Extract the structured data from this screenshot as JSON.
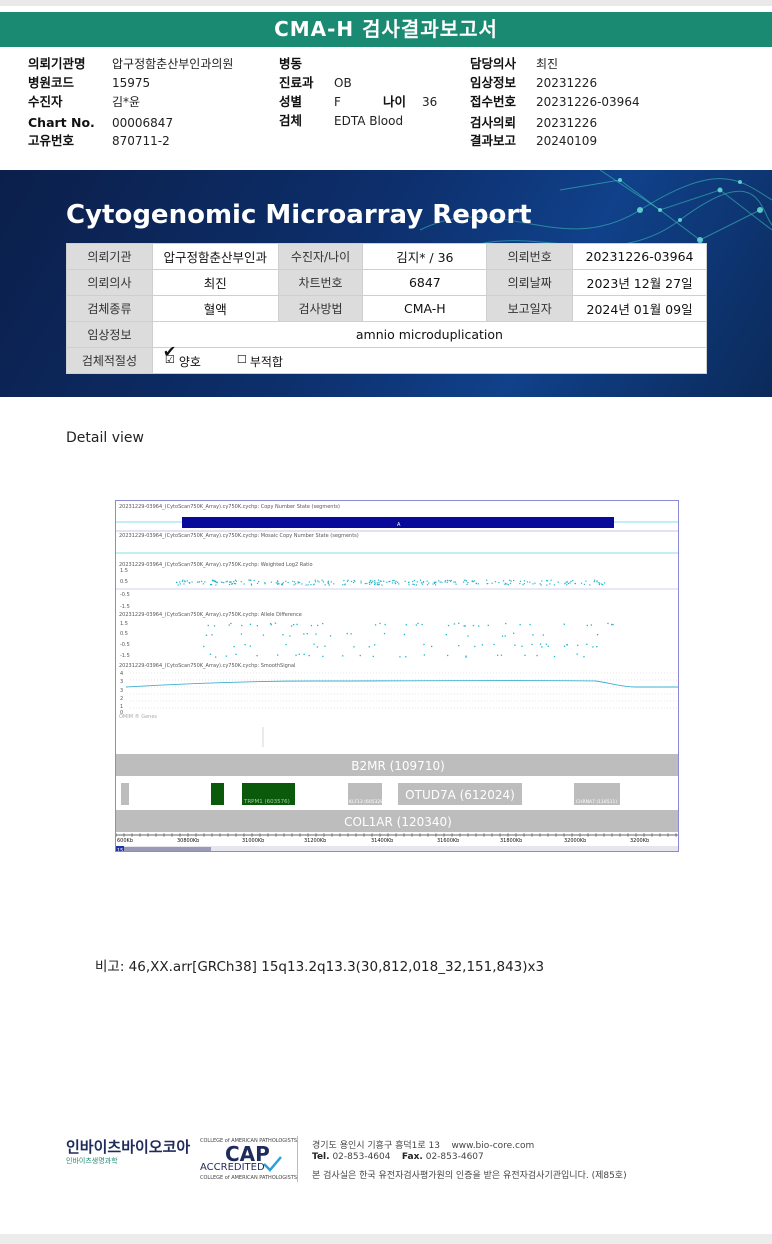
{
  "header": {
    "title": "CMA-H 검사결과보고서"
  },
  "info": {
    "col1": [
      {
        "label": "의뢰기관명",
        "value": "압구정함춘산부인과의원"
      },
      {
        "label": "병원코드",
        "value": "15975"
      },
      {
        "label": "수진자",
        "value": "김*윤"
      },
      {
        "label": "Chart No.",
        "value": "00006847"
      },
      {
        "label": "고유번호",
        "value": "870711-2"
      }
    ],
    "col2": [
      {
        "label": "병동",
        "value": ""
      },
      {
        "label": "진료과",
        "value": "OB"
      },
      {
        "label": "성별",
        "value": "F"
      },
      {
        "label": "검체",
        "value": "EDTA Blood"
      }
    ],
    "age_label": "나이",
    "age_value": "36",
    "col3": [
      {
        "label": "담당의사",
        "value": "최진"
      },
      {
        "label": "임상정보",
        "value": "20231226"
      },
      {
        "label": "접수번호",
        "value": "20231226-03964"
      },
      {
        "label": "검사의뢰",
        "value": "20231226"
      },
      {
        "label": "결과보고",
        "value": "20240109"
      }
    ]
  },
  "report": {
    "title": "Cytogenomic Microarray Report",
    "rows": [
      [
        "의뢰기관",
        "압구정함춘산부인과",
        "수진자/나이",
        "김지* / 36",
        "의뢰번호",
        "20231226-03964"
      ],
      [
        "의뢰의사",
        "최진",
        "차트번호",
        "6847",
        "의뢰날짜",
        "2023년 12월 27일"
      ],
      [
        "검체종류",
        "혈액",
        "검사방법",
        "CMA-H",
        "보고일자",
        "2024년 01월 09일"
      ]
    ],
    "clinical_label": "임상정보",
    "clinical_value": "amnio microduplication",
    "adequacy_label": "검체적절성",
    "adequacy_ok": "양호",
    "adequacy_ng": "부적합",
    "check_mark": "✔",
    "box_checked": "☑",
    "box_empty": "☐"
  },
  "detail": {
    "label": "Detail view"
  },
  "figure": {
    "track_titles": [
      "20231229-03964_(CytoScan750K_Array).cy750K.cychp: Copy Number State (segments)",
      "20231229-03964_(CytoScan750K_Array).cy750K.cychp: Mosaic Copy Number State (segments)",
      "20231229-03964_(CytoScan750K_Array).cy750K.cychp: Weighted Log2 Ratio",
      "20231229-03964_(CytoScan750K_Array).cy750K.cychp: Allele Difference",
      "20231229-03964_(CytoScan750K_Array).cy750K.cychp: SmoothSignal"
    ],
    "segment_label": "A",
    "log2_ticks": [
      "1.5",
      "0.5",
      "-0.5",
      "-1.5"
    ],
    "allele_ticks": [
      "1.5",
      "0.5",
      "-0.5",
      "-1.5"
    ],
    "smooth_ticks": [
      "4",
      "3",
      "3",
      "2",
      "1",
      "0"
    ],
    "omim_label": "OMIM ® Genes",
    "gene_b2mr": "B2MR (109710)",
    "gene_trpm1": "TRPM1 (603576)",
    "gene_klf13": "KLF13 (605328)",
    "gene_otud7a": "OTUD7A (612024)",
    "gene_chrna7": "CHRNA7 (118511)",
    "gene_col1ar": "COL1AR (120340)",
    "axis_ticks": [
      "600Kb",
      "30800Kb",
      "31000Kb",
      "31200Kb",
      "31400Kb",
      "31600Kb",
      "31800Kb",
      "32000Kb",
      "3200Kb"
    ],
    "scroll_label": "15",
    "colors": {
      "segment": "#0a0a9a",
      "points": "#1fb5c9",
      "gene_dark": "#0b5a0b",
      "gene_grey": "#bdbdbd"
    }
  },
  "remark": "비고: 46,XX.arr[GRCh38] 15q13.2q13.3(30,812,018_32,151,843)x3",
  "footer": {
    "company": "인바이츠바이오코아",
    "company_sub": "인바이츠생명과학",
    "cap_top": "COLLEGE of AMERICAN PATHOLOGISTS",
    "cap_big": "CAP",
    "cap_acc": "ACCREDITED",
    "cap_bottom": "COLLEGE of AMERICAN PATHOLOGISTS",
    "address": "경기도 용인시 기흥구 흥덕1로 13",
    "website": "www.bio-core.com",
    "tel_label": "Tel.",
    "tel": "02-853-4604",
    "fax_label": "Fax.",
    "fax": "02-853-4607",
    "notice": "본 검사실은 한국 유전자검사평가원의 인증을 받은 유전자검사기관입니다. (제85호)"
  }
}
